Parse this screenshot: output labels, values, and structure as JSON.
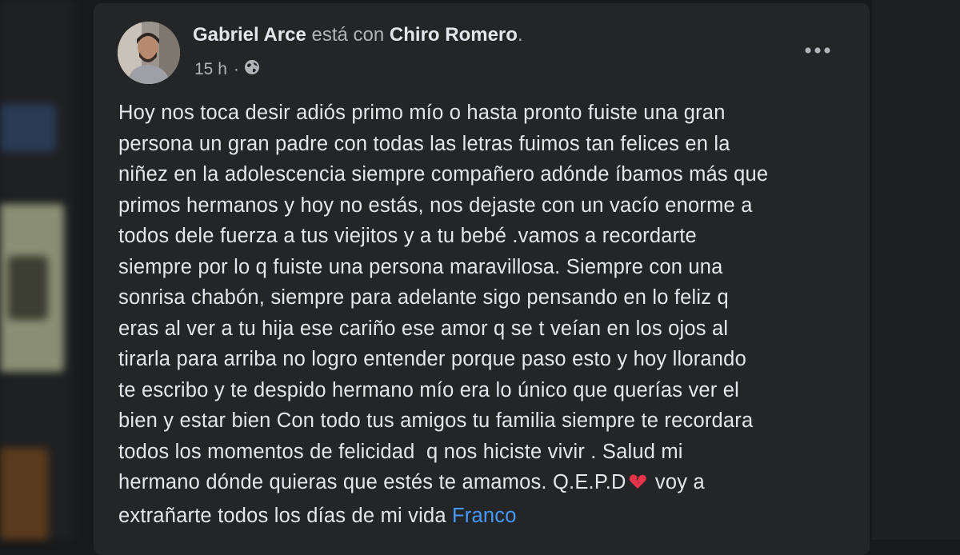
{
  "post": {
    "author": "Gabriel Arce",
    "with_text": "está con",
    "tagged": "Chiro Romero",
    "period": ".",
    "time": "15 h",
    "separator": "·",
    "privacy_icon": "globe-icon",
    "more_icon": "more-options-icon",
    "body_lines": [
      "Hoy nos toca desir adiós primo mío o hasta pronto fuiste una gran",
      "persona un gran padre con todas las letras fuimos tan felices en la",
      "niñez en la adolescencia siempre compañero adónde íbamos más que",
      "primos hermanos y hoy no estás, nos dejaste con un vacío enorme a",
      "todos dele fuerza a tus viejitos y a tu bebé .vamos a recordarte",
      "siempre por lo q fuiste una persona maravillosa. Siempre con una",
      "sonrisa chabón, siempre para adelante sigo pensando en lo feliz q",
      "eras al ver a tu hija ese cariño ese amor q se t veían en los ojos al",
      "tirarla para arriba no logro entender porque paso esto y hoy llorando",
      "te escribo y te despido hermano mío era lo único que querías ver el",
      "bien y estar bien Con todo tus amigos tu familia siempre te recordara",
      "todos los momentos de felicidad  q nos hiciste vivir . Salud mi"
    ],
    "line13_before_emoji": "hermano dónde quieras que estés te amamos. Q.E.P.D",
    "emoji": "broken-heart-icon",
    "line13_after_emoji": " voy a",
    "line14_text": "extrañarte todos los días de mi vida ",
    "mention": "Franco"
  },
  "colors": {
    "background": "#18191a",
    "card": "#242526",
    "primary_text": "#e4e6eb",
    "secondary_text": "#b0b3b8",
    "link": "#4599ff",
    "heart": "#e8334a"
  }
}
